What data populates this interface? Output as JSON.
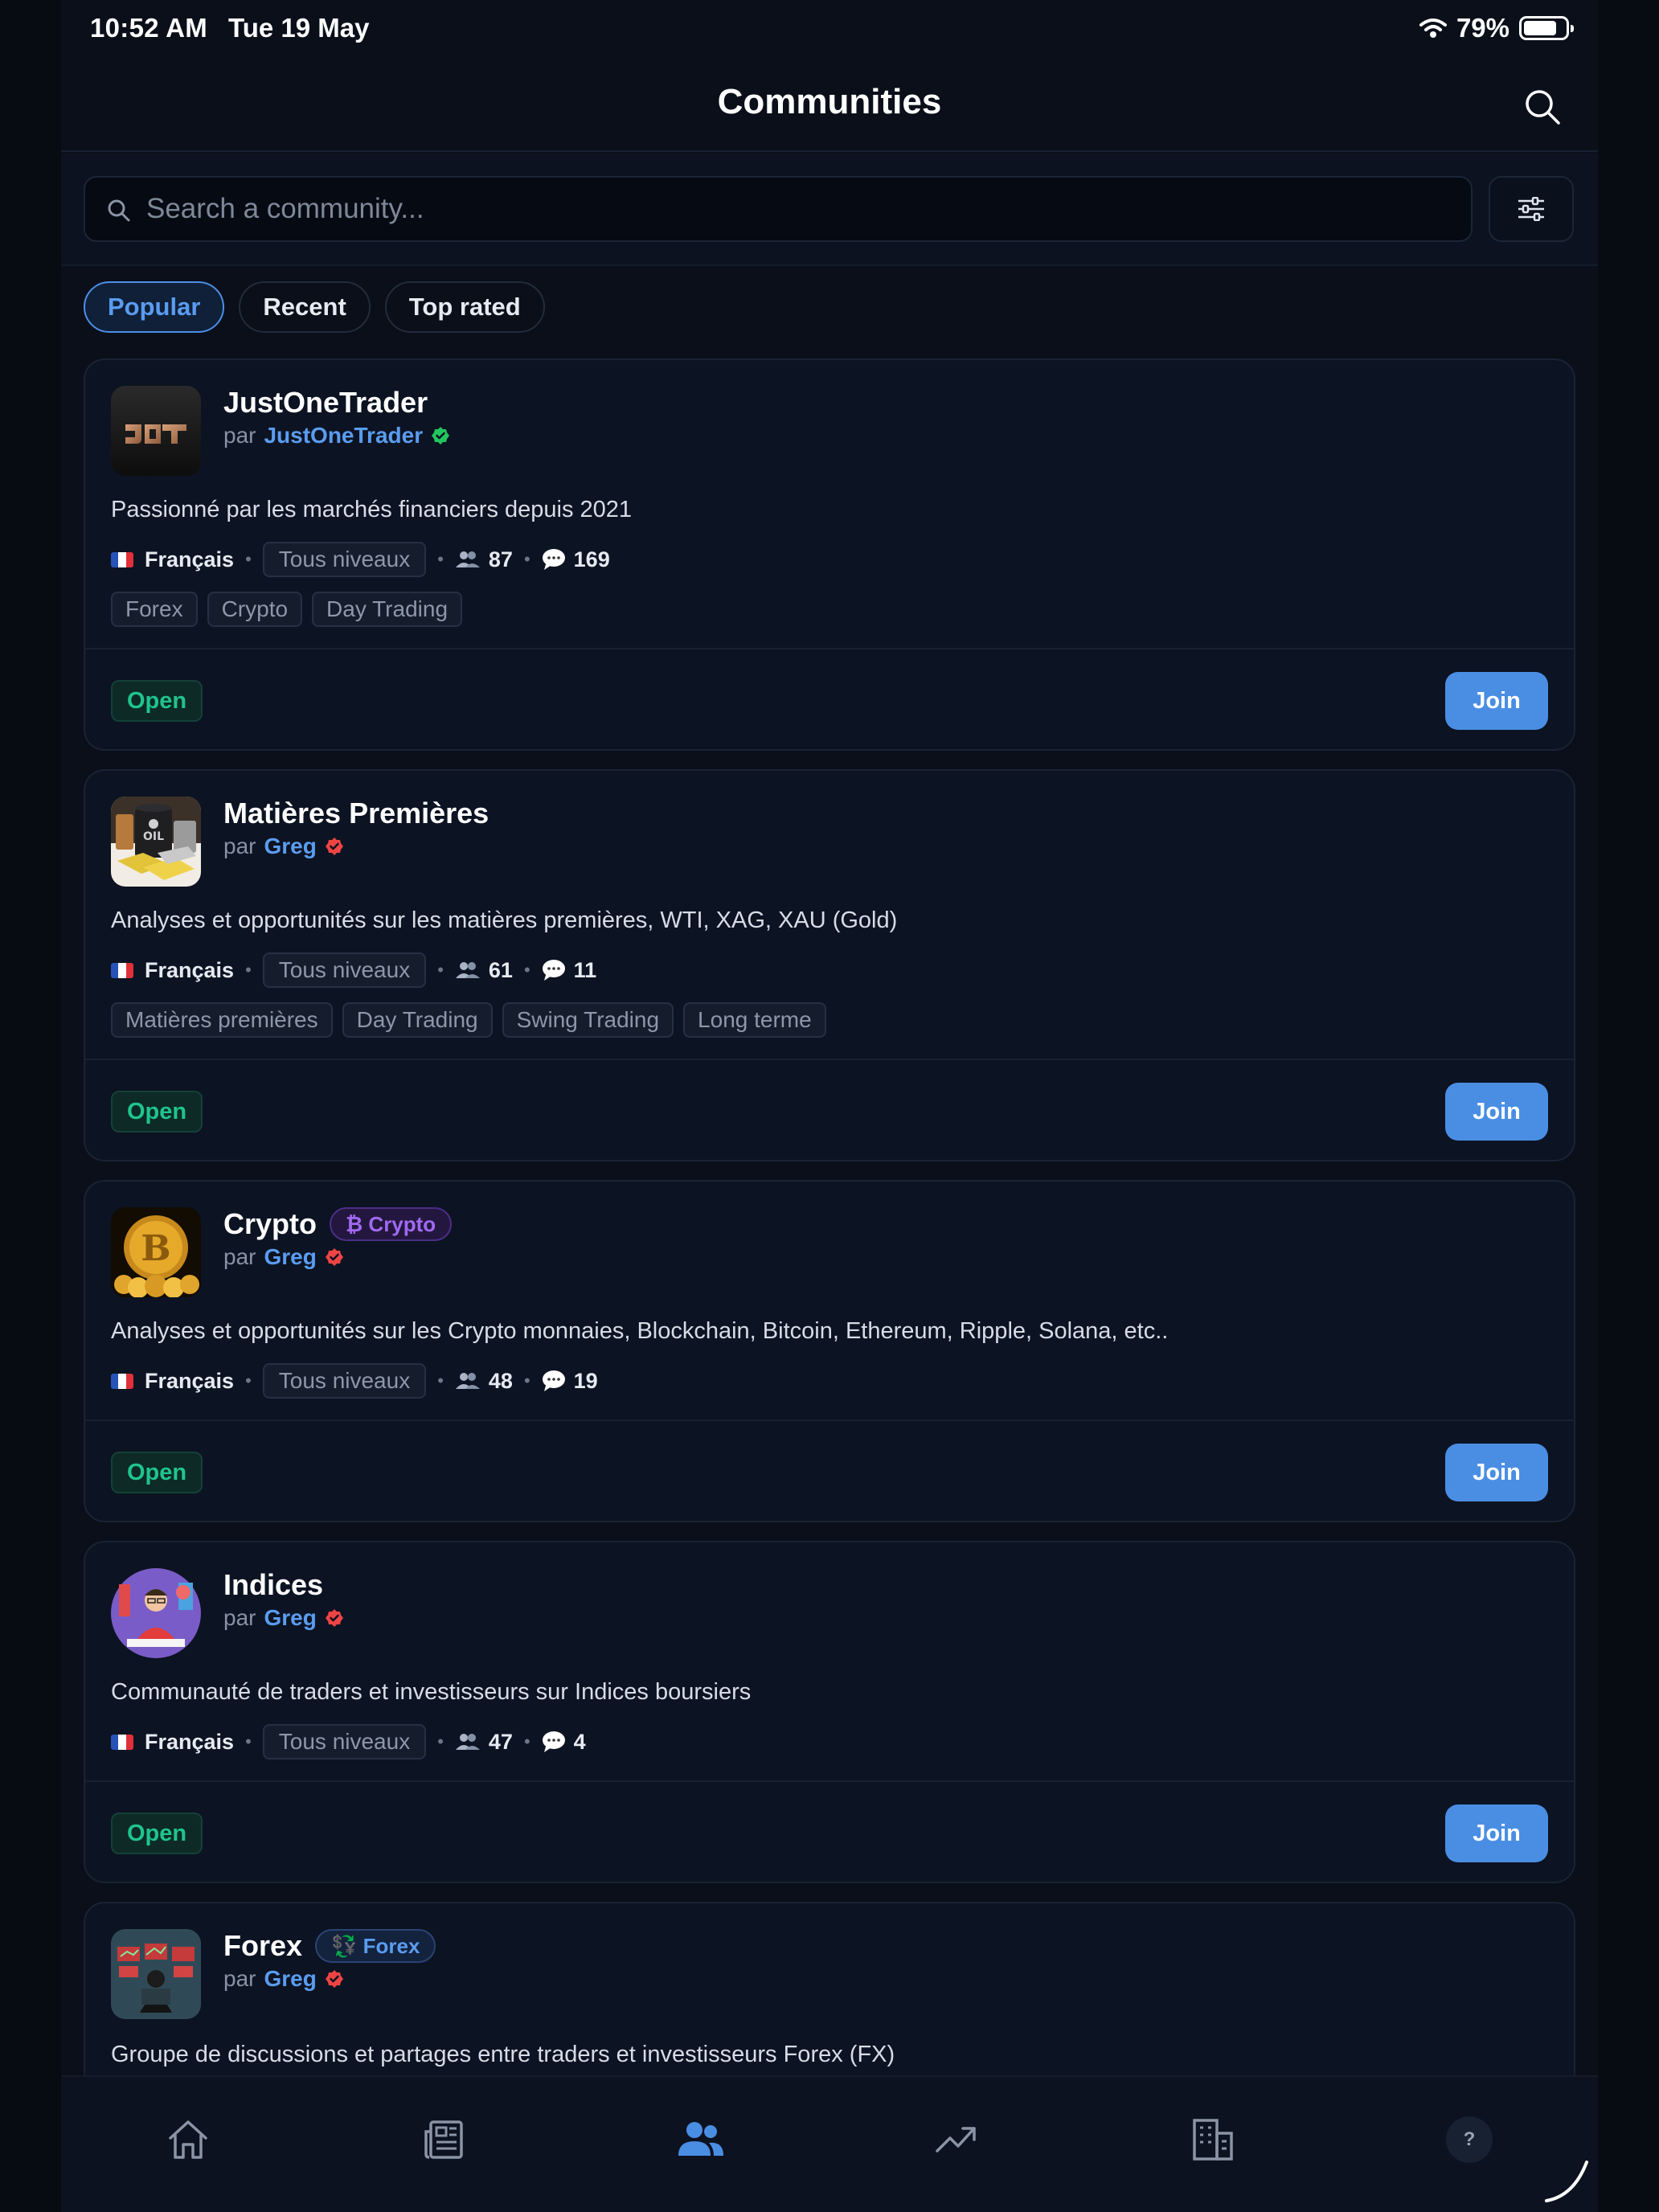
{
  "status_bar": {
    "time": "10:52 AM",
    "date": "Tue 19 May",
    "battery": "79%",
    "battery_level": 0.79
  },
  "header": {
    "title": "Communities"
  },
  "search": {
    "placeholder": "Search a community...",
    "value": ""
  },
  "tabs": [
    {
      "label": "Popular",
      "active": true
    },
    {
      "label": "Recent",
      "active": false
    },
    {
      "label": "Top rated",
      "active": false
    }
  ],
  "communities": [
    {
      "name": "JustOneTrader",
      "by_prefix": "par",
      "author": "JustOneTrader",
      "verified_color": "#22c55e",
      "description": "Passionné par les marchés financiers depuis 2021",
      "language": "Français",
      "level": "Tous niveaux",
      "members": "87",
      "messages": "169",
      "tags": [
        "Forex",
        "Crypto",
        "Day Trading"
      ],
      "status": "Open",
      "action": "Join"
    },
    {
      "name": "Matières Premières",
      "by_prefix": "par",
      "author": "Greg",
      "verified_color": "#ef4444",
      "description": "Analyses et opportunités sur les matières premières, WTI, XAG, XAU (Gold)",
      "language": "Français",
      "level": "Tous niveaux",
      "members": "61",
      "messages": "11",
      "tags": [
        "Matières premières",
        "Day Trading",
        "Swing Trading",
        "Long terme"
      ],
      "status": "Open",
      "action": "Join"
    },
    {
      "name": "Crypto",
      "category": "₿ Crypto",
      "by_prefix": "par",
      "author": "Greg",
      "verified_color": "#ef4444",
      "description": "Analyses et opportunités sur les Crypto monnaies, Blockchain, Bitcoin, Ethereum, Ripple, Solana, etc..",
      "language": "Français",
      "level": "Tous niveaux",
      "members": "48",
      "messages": "19",
      "status": "Open",
      "action": "Join"
    },
    {
      "name": "Indices",
      "by_prefix": "par",
      "author": "Greg",
      "verified_color": "#ef4444",
      "description": "Communauté de traders et investisseurs sur Indices boursiers",
      "language": "Français",
      "level": "Tous niveaux",
      "members": "47",
      "messages": "4",
      "status": "Open",
      "action": "Join"
    },
    {
      "name": "Forex",
      "category": "💱 Forex",
      "by_prefix": "par",
      "author": "Greg",
      "verified_color": "#ef4444",
      "description": "Groupe de discussions et partages entre traders et investisseurs Forex (FX)"
    }
  ],
  "tab_bar": {
    "items": [
      "home-icon",
      "news-icon",
      "communities-icon",
      "trending-icon",
      "companies-icon",
      "help-icon"
    ],
    "active": "communities-icon",
    "help_label": "?"
  },
  "colors": {
    "accent": "#4a8ee4",
    "open_green": "#1fc48c",
    "background": "#0a0f1a"
  }
}
